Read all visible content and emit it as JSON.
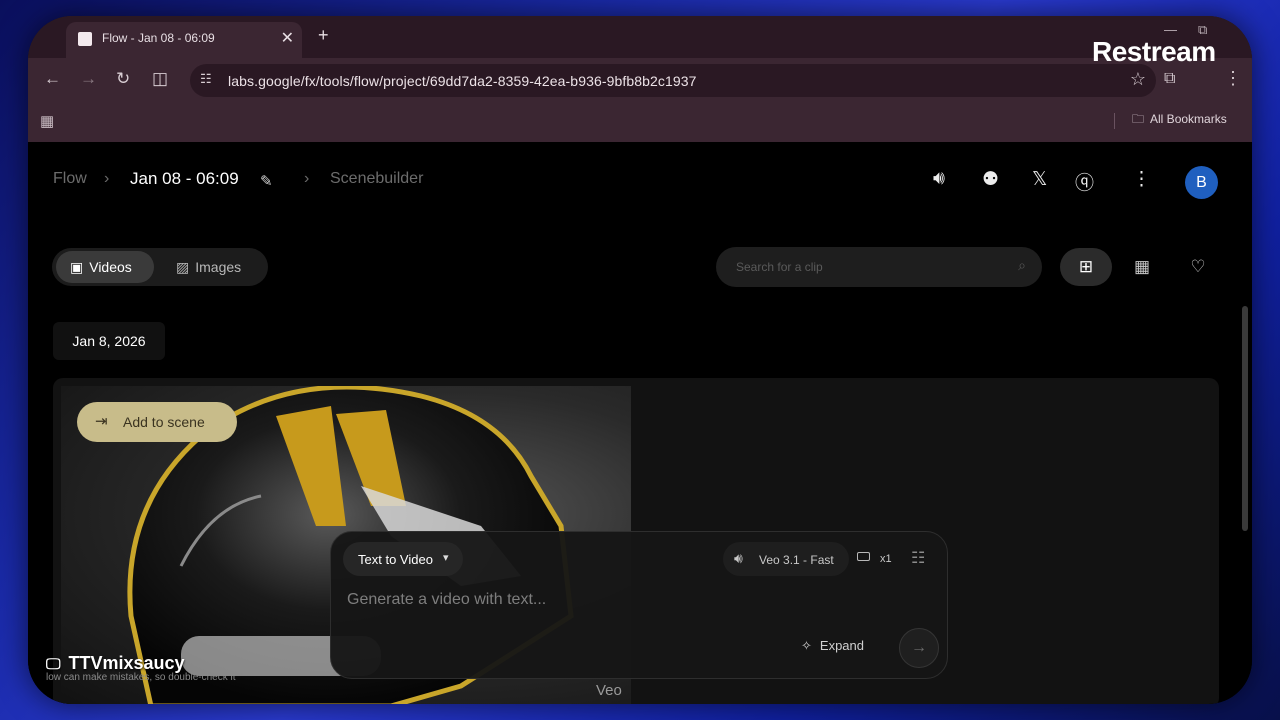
{
  "browser": {
    "tab_title": "Flow - Jan 08 - 06:09",
    "url": "labs.google/fx/tools/flow/project/69dd7da2-8359-42ea-b936-9bfb8b2c1937",
    "bookmarks_label": "All Bookmarks"
  },
  "header": {
    "crumb_root": "Flow",
    "project_name": "Jan 08 - 06:09",
    "crumb_current": "Scenebuilder",
    "avatar_initial": "B"
  },
  "toolbar": {
    "tab_videos": "Videos",
    "tab_images": "Images",
    "search_placeholder": "Search for a clip"
  },
  "content": {
    "date_label": "Jan 8, 2026",
    "add_to_scene": "Add to scene",
    "watermark": "Veo"
  },
  "composer": {
    "mode": "Text to Video",
    "model": "Veo 3.1 - Fast",
    "count": "x1",
    "placeholder": "Generate a video with text...",
    "expand": "Expand"
  },
  "footer": {
    "disclaimer": "low can make mistakes, so double-check it"
  },
  "overlays": {
    "brand": "Restream",
    "streamer": "TTVmixsaucy"
  },
  "colors": {
    "chrome": "#3b2632",
    "app_bg": "#000000",
    "avatar": "#1f5fbf",
    "add_to_scene": "#c8bc8a"
  },
  "icons": [
    "tab-favicon",
    "close-icon",
    "plus-icon",
    "back-icon",
    "forward-icon",
    "reload-icon",
    "sidepanel-icon",
    "site-settings-icon",
    "star-icon",
    "extensions-icon",
    "more-vert-icon",
    "apps-icon",
    "folder-icon",
    "edit-icon",
    "volume-icon",
    "discord-icon",
    "x-icon",
    "help-icon",
    "videocam-icon",
    "image-icon",
    "search-icon",
    "grid-icon",
    "table-icon",
    "heart-icon",
    "add-to-scene-icon",
    "volume-icon",
    "aspect-ratio-icon",
    "tune-icon",
    "expand-icon",
    "arrow-right-icon",
    "monitor-icon"
  ]
}
